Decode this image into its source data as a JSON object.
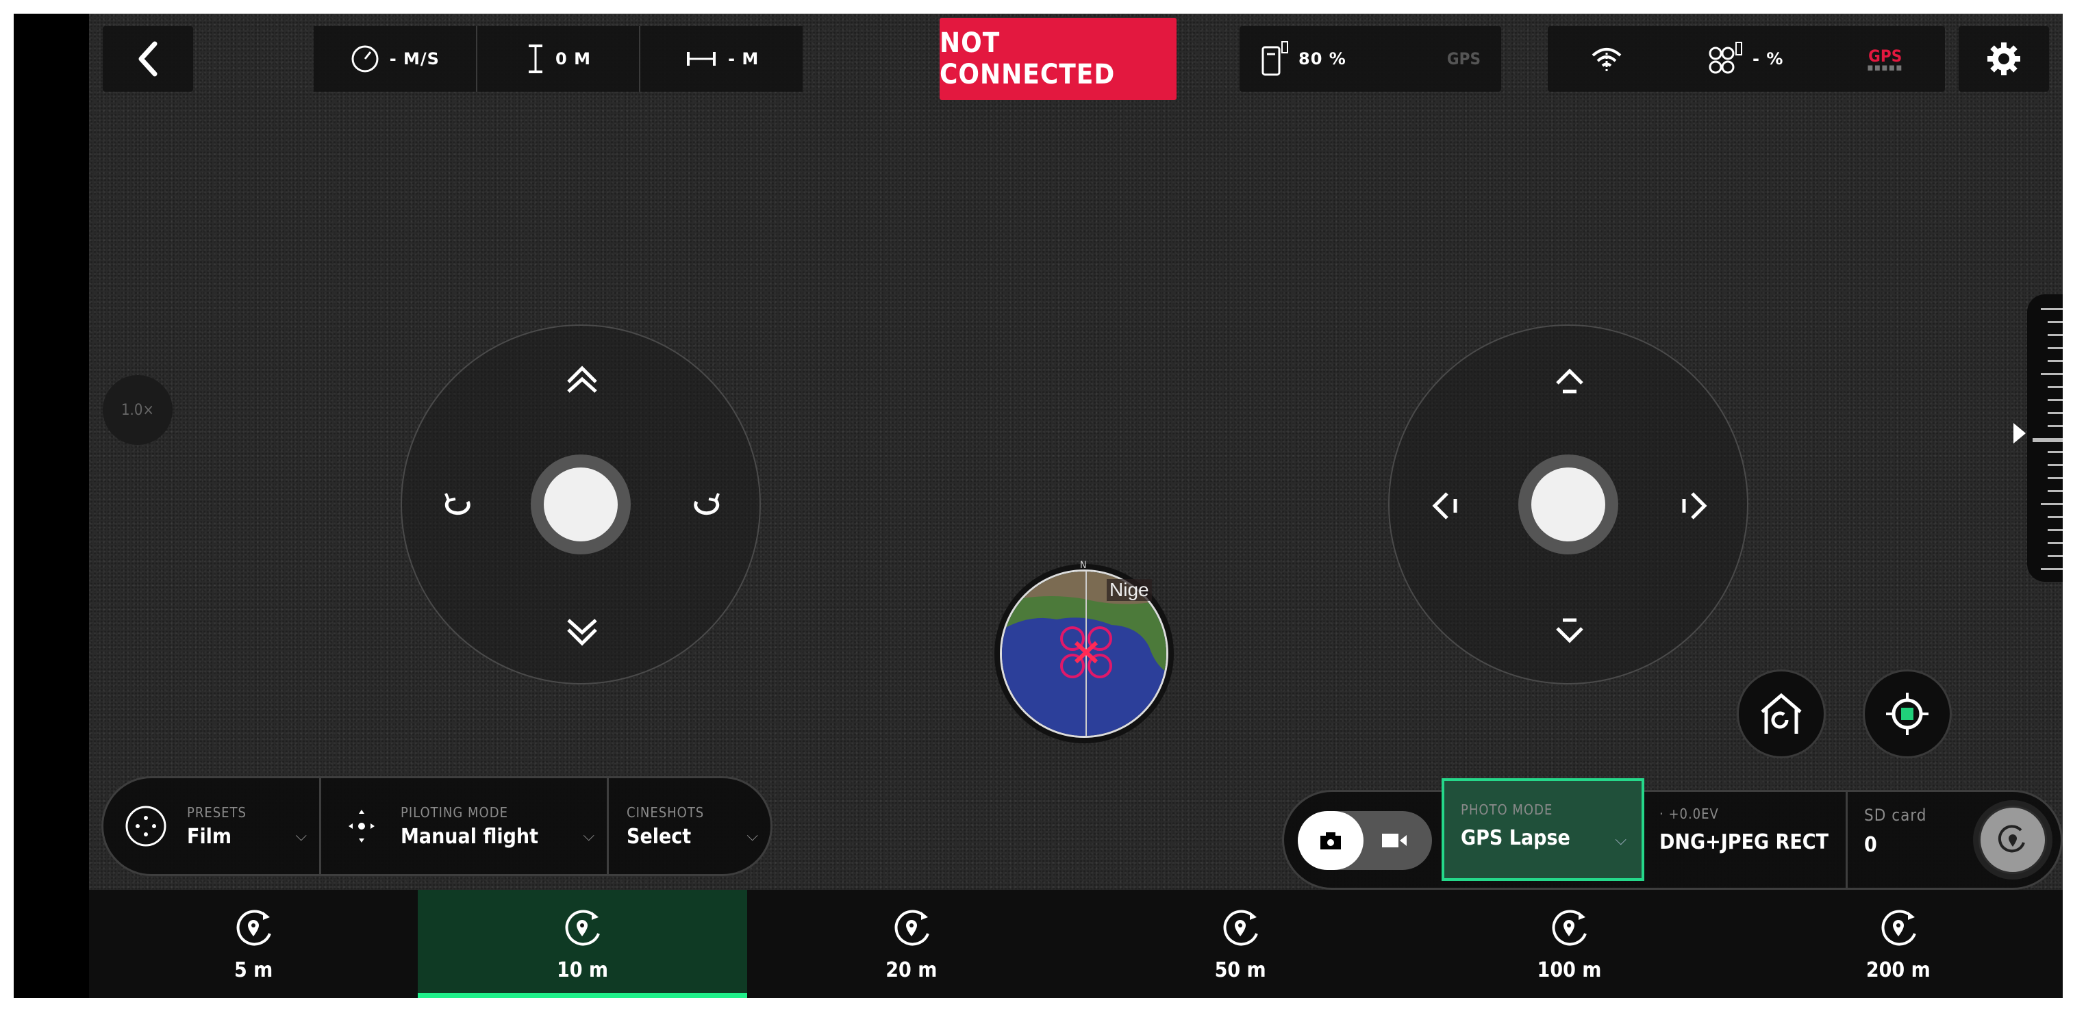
{
  "topbar": {
    "back_icon": "chevron-left-icon",
    "telemetry": [
      {
        "icon": "speedometer-icon",
        "value": "- M/S"
      },
      {
        "icon": "altitude-icon",
        "value": "0 M"
      },
      {
        "icon": "distance-icon",
        "value": "- M"
      }
    ],
    "connection_status": "NOT CONNECTED",
    "controller_battery": "80 %",
    "controller_gps": "GPS",
    "drone_battery": "- %",
    "drone_gps": "GPS",
    "settings_icon": "gear-icon"
  },
  "zoom_level": "1.0×",
  "minimap": {
    "north_label": "N",
    "place_label": "Nige"
  },
  "presets_panel": {
    "presets": {
      "label": "PRESETS",
      "value": "Film"
    },
    "piloting_mode": {
      "label": "PILOTING MODE",
      "value": "Manual flight"
    },
    "cineshots": {
      "label": "CINESHOTS",
      "value": "Select"
    }
  },
  "camera_panel": {
    "photo_mode": {
      "label": "PHOTO MODE",
      "value": "GPS Lapse"
    },
    "exposure": {
      "label": "+0.0EV",
      "value": "DNG+JPEG RECT"
    },
    "sd_card": {
      "label": "SD card",
      "value": "0"
    }
  },
  "distance_options": [
    {
      "label": "5 m",
      "active": false
    },
    {
      "label": "10 m",
      "active": true
    },
    {
      "label": "20 m",
      "active": false
    },
    {
      "label": "50 m",
      "active": false
    },
    {
      "label": "100 m",
      "active": false
    },
    {
      "label": "200 m",
      "active": false
    }
  ],
  "colors": {
    "alert_red": "#e3183f",
    "active_green": "#20f08a",
    "active_bg": "#0f3a24"
  }
}
